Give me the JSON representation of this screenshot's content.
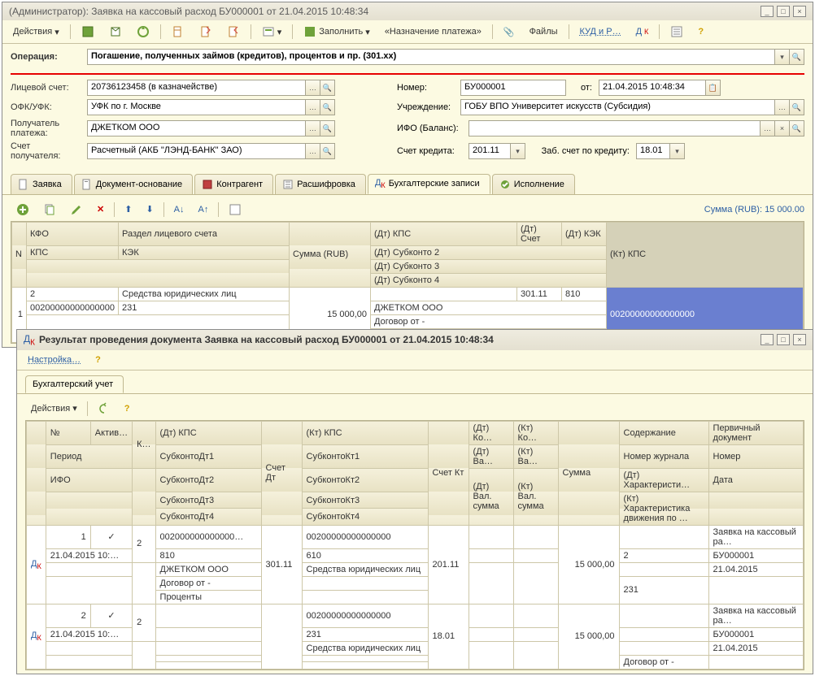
{
  "main": {
    "title": "(Администратор): Заявка на кассовый расход БУ000001 от 21.04.2015 10:48:34",
    "toolbar": {
      "actions": "Действия",
      "fill": "Заполнить",
      "payment_purpose": "«Назначение платежа»",
      "files": "Файлы",
      "kudir": "КУД и Р…"
    },
    "form": {
      "operation_label": "Операция:",
      "operation": "Погашение, полученных займов (кредитов), процентов и пр. (301.xx)",
      "ls_label": "Лицевой счет:",
      "ls": "20736123458 (в казначействе)",
      "number_label": "Номер:",
      "number": "БУ000001",
      "ot_label": "от:",
      "date": "21.04.2015 10:48:34",
      "ofk_label": "ОФК/УФК:",
      "ofk": "УФК по г. Москве",
      "org_label": "Учреждение:",
      "org": "ГОБУ ВПО Университет искусств (Субсидия)",
      "payee_label": "Получатель платежа:",
      "payee": "ДЖЕТКОМ ООО",
      "ifo_label": "ИФО (Баланс):",
      "account_label": "Счет получателя:",
      "account": "Расчетный (АКБ \"ЛЭНД-БАНК\" ЗАО)",
      "credit_label": "Счет кредита:",
      "credit_acc": "201.11",
      "zab_label": "Заб. счет по кредиту:",
      "zab": "18.01"
    },
    "tabs": {
      "t1": "Заявка",
      "t2": "Документ-основание",
      "t3": "Контрагент",
      "t4": "Расшифровка",
      "t5": "Бухгалтерские записи",
      "t6": "Исполнение"
    },
    "total": "Сумма (RUB): 15 000.00",
    "ghead": {
      "n": "N",
      "kfo": "КФО",
      "razdel": "Раздел лицевого счета",
      "summa": "Сумма (RUB)",
      "dt_kps": "(Дт) КПС",
      "dt_schet": "(Дт) Счет",
      "dt_kek": "(Дт) КЭК",
      "kt_kps": "(Кт) КПС",
      "kps": "КПС",
      "kek": "КЭК",
      "dt_s2": "(Дт) Субконто 2",
      "dt_s3": "(Дт) Субконто 3",
      "dt_s4": "(Дт) Субконто 4"
    },
    "grow": {
      "n": "1",
      "kfo": "2",
      "razdel": "Средства юридических лиц",
      "summa": "15 000,00",
      "dt_schet": "301.11",
      "dt_kek": "810",
      "kt_kps": "00200000000000000",
      "kps": "00200000000000000",
      "kek": "231",
      "s2": "ДЖЕТКОМ ООО",
      "s3": "Договор  от  -",
      "s4": "Проценты"
    }
  },
  "modal": {
    "title": "Результат проведения документа Заявка на кассовый расход БУ000001 от 21.04.2015 10:48:34",
    "settings": "Настройка…",
    "tab": "Бухгалтерский учет",
    "actions": "Действия",
    "head": {
      "num": "№",
      "aktiv": "Актив…",
      "k": "К…",
      "dt_kps": "(Дт) КПС",
      "schet_dt": "Счет Дт",
      "kt_kps": "(Кт) КПС",
      "schet_kt": "Счет Кт",
      "dt_ko": "(Дт) Ко…",
      "kt_ko": "(Кт) Ко…",
      "summa": "Сумма",
      "soder": "Содержание",
      "pdoc": "Первичный документ",
      "period": "Период",
      "subdt1": "СубконтоДт1",
      "subkt1": "СубконтоКт1",
      "dt_va": "(Дт) Ва…",
      "kt_va": "(Кт) Ва…",
      "nzhur": "Номер журнала",
      "nomer": "Номер",
      "ifo": "ИФО",
      "subdt2": "СубконтоДт2",
      "subkt2": "СубконтоКт2",
      "dt_val_s": "(Дт) Вал. сумма",
      "kt_val_s": "(Кт) Вал. сумма",
      "dt_har": "(Дт) Характеристи…",
      "data": "Дата",
      "subdt3": "СубконтоДт3",
      "subkt3": "СубконтоКт3",
      "kt_har": "(Кт) Характеристика движения по …",
      "subdt4": "СубконтоДт4",
      "subkt4": "СубконтоКт4"
    },
    "r1": {
      "n": "1",
      "k": "2",
      "dt_kps": "002000000000000…",
      "schet_dt": "301.11",
      "kt_kps": "00200000000000000",
      "schet_kt": "201.11",
      "summa": "15 000,00",
      "pdoc": "Заявка на кассовый ра…",
      "period": "21.04.2015 10:…",
      "subdt1": "810",
      "subkt1": "610",
      "nzhur": "2",
      "nomer": "БУ000001",
      "subdt2": "ДЖЕТКОМ ООО",
      "subkt2": "Средства юридических лиц",
      "data": "21.04.2015",
      "subdt3": "Договор  от  -",
      "kt_har": "231",
      "subdt4": "Проценты"
    },
    "r2": {
      "n": "2",
      "k": "2",
      "kt_kps": "00200000000000000",
      "schet_kt": "18.01",
      "summa": "15 000,00",
      "pdoc": "Заявка на кассовый ра…",
      "period": "21.04.2015 10:…",
      "subkt1": "231",
      "nomer": "БУ000001",
      "subkt2": "Средства юридических лиц",
      "data": "21.04.2015",
      "kt_har": "Договор  от  -"
    }
  }
}
